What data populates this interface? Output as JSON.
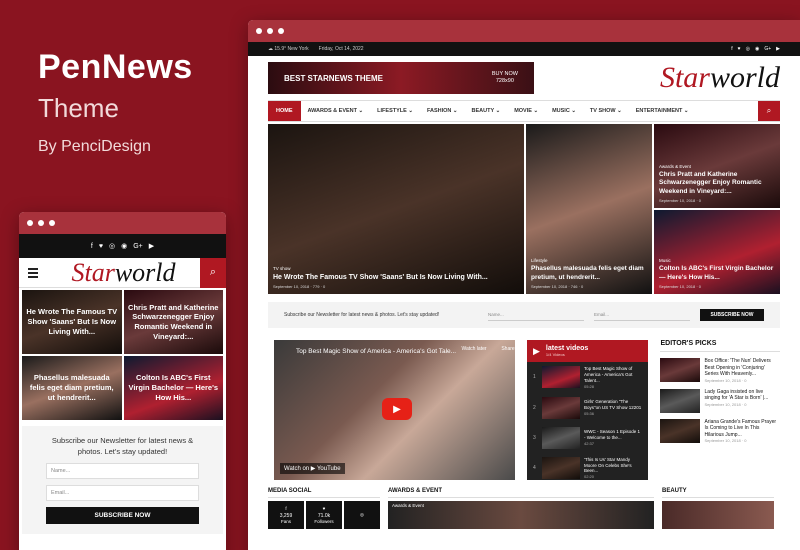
{
  "brand": {
    "title": "PenNews",
    "subtitle": "Theme",
    "by": "By PenciDesign"
  },
  "mobile": {
    "social": [
      "f",
      "♥",
      "◎",
      "◉",
      "G+",
      "▶"
    ],
    "logo_a": "Star",
    "logo_b": "world",
    "cards": [
      "He Wrote The Famous TV Show 'Saans' But Is Now Living With...",
      "Chris Pratt and Katherine Schwarzenegger Enjoy Romantic Weekend in Vineyard:...",
      "Phasellus malesuada felis eget diam pretium, ut hendrerit...",
      "Colton Is ABC's First Virgin Bachelor — Here's How His..."
    ],
    "newsletter": "Subscribe our Newsletter for latest news & photos. Let's stay updated!",
    "name_ph": "Name...",
    "email_ph": "Email...",
    "button": "SUBSCRIBE NOW"
  },
  "desktop": {
    "topbar": {
      "weather": "☁ 15.9° New York",
      "date": "Friday, Oct 14, 2022",
      "social": [
        "f",
        "♥",
        "◎",
        "◉",
        "G+",
        "▶"
      ]
    },
    "ad": {
      "title": "BEST STARNEWS THEME",
      "right1": "BUY NOW",
      "right2": "728x90"
    },
    "logo_a": "Star",
    "logo_b": "world",
    "nav": [
      "HOME",
      "AWARDS & EVENT ⌄",
      "LIFESTYLE ⌄",
      "FASHION ⌄",
      "BEAUTY ⌄",
      "MOVIE ⌄",
      "MUSIC ⌄",
      "TV SHOW ⌄",
      "ENTERTAINMENT ⌄"
    ],
    "hero": [
      {
        "cat": "TV show",
        "title": "He Wrote The Famous TV Show 'Saans' But Is Now Living With...",
        "meta": "September 10, 2018 · 779 · 0"
      },
      {
        "cat": "Awards & Event",
        "title": "Chris Pratt and Katherine Schwarzenegger Enjoy Romantic Weekend in Vineyard:...",
        "meta": "September 10, 2018 · 0"
      },
      {
        "cat": "Music",
        "title": "Colton Is ABC's First Virgin Bachelor — Here's How His...",
        "meta": "September 10, 2018 · 0"
      },
      {
        "cat": "Lifestyle",
        "title": "Phasellus malesuada felis eget diam pretium, ut hendrerit...",
        "meta": "September 10, 2018 · 746 · 0"
      }
    ],
    "newsletter": {
      "text": "Subscribe our Newsletter for latest news & photos. Let's stay updated!",
      "name_ph": "Name...",
      "email_ph": "Email...",
      "button": "SUBSCRIBE NOW"
    },
    "video": {
      "title": "Top Best Magic Show of America - America's Got Tale...",
      "watch_later": "Watch later",
      "share": "Share",
      "watch_on": "Watch on ▶ YouTube"
    },
    "playlist": {
      "title": "latest videos",
      "count": "1/4 Videos",
      "items": [
        {
          "n": "1",
          "title": "Top Best Magic Show of America - America's Got Talent...",
          "dur": "05:28"
        },
        {
          "n": "2",
          "title": "Girls' Generation \"The Boys\"on US TV Show 12201",
          "dur": "05:36"
        },
        {
          "n": "3",
          "title": "WWC - Season 1 Episode 1 - Welcome to the...",
          "dur": "42:37"
        },
        {
          "n": "4",
          "title": "'This Is Us' Star Mandy Moore On Celebs She's Been...",
          "dur": "02:20"
        }
      ]
    },
    "picks": {
      "title": "EDITOR'S PICKS",
      "items": [
        {
          "title": "Box Office: 'The Nun' Delivers Best Opening in 'Conjuring' Series With Heavenly...",
          "date": "September 10, 2018 · 0"
        },
        {
          "title": "Lady Gaga insisted on live singing for 'A Star is Born' |...",
          "date": "September 10, 2018 · 0"
        },
        {
          "title": "Ariana Grande's Famous Prayer Is Coming to Live In This Hilarious Jump...",
          "date": "September 10, 2018 · 0"
        }
      ]
    },
    "bottom": {
      "media": "MEDIA SOCIAL",
      "awards": "AWARDS & EVENT",
      "beauty": "BEAUTY",
      "social": [
        {
          "i": "f",
          "v": "3,259",
          "l": "Fans"
        },
        {
          "i": "♥",
          "v": "71.0k",
          "l": "Followers"
        },
        {
          "i": "◎",
          "v": "",
          "l": ""
        }
      ],
      "awards_cat": "Awards & Event"
    }
  }
}
